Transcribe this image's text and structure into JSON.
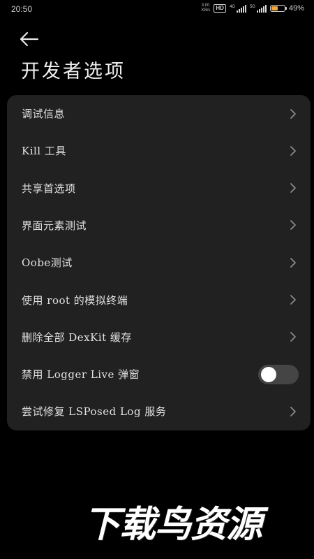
{
  "status_bar": {
    "time": "20:50",
    "net_speed_value": "3.00",
    "net_speed_unit": "KB/s",
    "hd_label": "HD",
    "sim1_network": "4G",
    "sim2_network": "5G",
    "battery_percent": "49%",
    "battery_level": 0.49,
    "battery_color": "#f2a53a"
  },
  "header": {
    "title": "开发者选项"
  },
  "settings": {
    "items": [
      {
        "label": "调试信息",
        "control": "chevron"
      },
      {
        "label": "Kill 工具",
        "control": "chevron"
      },
      {
        "label": "共享首选项",
        "control": "chevron"
      },
      {
        "label": "界面元素测试",
        "control": "chevron"
      },
      {
        "label": "Oobe测试",
        "control": "chevron"
      },
      {
        "label": "使用 root 的模拟终端",
        "control": "chevron"
      },
      {
        "label": "删除全部 DexKit 缓存",
        "control": "chevron"
      },
      {
        "label": "禁用 Logger Live 弹窗",
        "control": "toggle",
        "toggle_on": false
      },
      {
        "label": "尝试修复 LSPosed Log 服务",
        "control": "chevron"
      }
    ]
  },
  "watermark": {
    "text": "下载鸟资源"
  },
  "icons": {
    "back": "arrow-left-icon",
    "chevron": "chevron-right-icon"
  }
}
